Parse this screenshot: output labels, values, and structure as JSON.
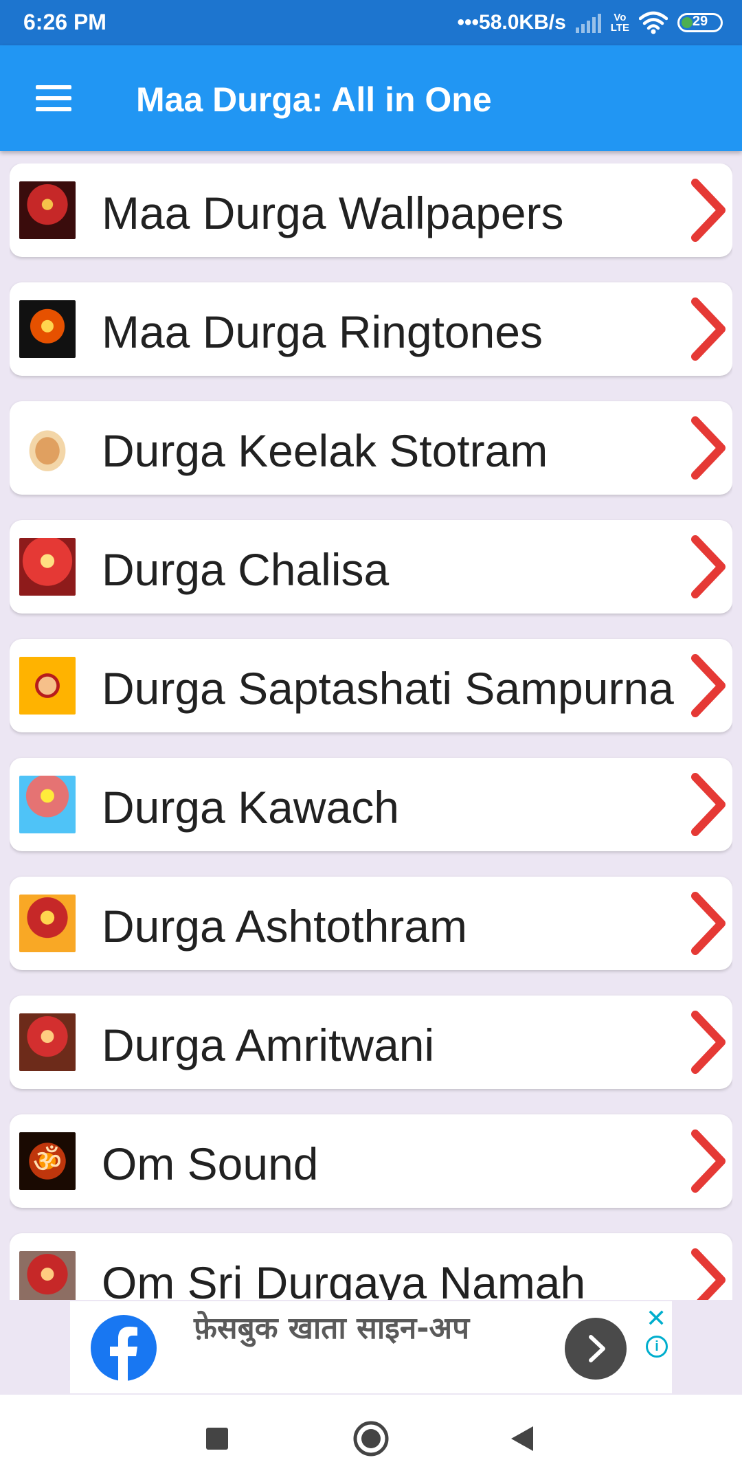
{
  "status_bar": {
    "time": "6:26 PM",
    "network_speed": "•••58.0KB/s",
    "volte_top": "Vo",
    "volte_bottom": "LTE",
    "battery": "29"
  },
  "app_bar": {
    "title": "Maa Durga: All in One",
    "menu_icon": "hamburger-menu-icon",
    "color": "#2196f3"
  },
  "menu": {
    "items": [
      {
        "label": "Maa Durga Wallpapers",
        "icon": "durga-wallpaper-thumbnail"
      },
      {
        "label": "Maa Durga Ringtones",
        "icon": "durga-ringtone-thumbnail"
      },
      {
        "label": "Durga Keelak Stotram",
        "icon": "durga-statue-thumbnail"
      },
      {
        "label": "Durga Chalisa",
        "icon": "durga-chalisa-thumbnail"
      },
      {
        "label": "Durga Saptashati Sampurna",
        "icon": "durga-face-thumbnail"
      },
      {
        "label": "Durga Kawach",
        "icon": "durga-kawach-thumbnail"
      },
      {
        "label": "Durga Ashtothram",
        "icon": "durga-ashtothram-thumbnail"
      },
      {
        "label": "Durga Amritwani",
        "icon": "durga-amritwani-thumbnail"
      },
      {
        "label": "Om Sound",
        "icon": "om-symbol-thumbnail"
      },
      {
        "label": "Om Sri Durgaya Namah",
        "icon": "durga-namah-thumbnail"
      }
    ],
    "chevron_color": "#e53935"
  },
  "ad": {
    "text": "फ़ेसबुक खाता साइन-अप",
    "logo": "facebook-logo-icon",
    "close_glyph": "✕",
    "info_glyph": "i"
  },
  "nav": {
    "recents": "square-recents-icon",
    "home": "circle-home-icon",
    "back": "triangle-back-icon"
  }
}
